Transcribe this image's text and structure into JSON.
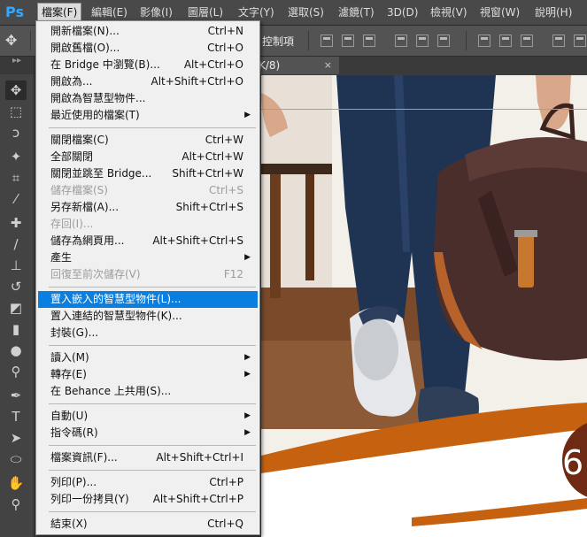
{
  "app": {
    "logo": "Ps"
  },
  "menubar": [
    {
      "label": "檔案(F)",
      "active": true
    },
    {
      "label": "編輯(E)"
    },
    {
      "label": "影像(I)"
    },
    {
      "label": "圖層(L)"
    },
    {
      "label": "文字(Y)"
    },
    {
      "label": "選取(S)"
    },
    {
      "label": "濾鏡(T)"
    },
    {
      "label": "3D(D)"
    },
    {
      "label": "檢視(V)"
    },
    {
      "label": "視窗(W)"
    },
    {
      "label": "說明(H)"
    }
  ],
  "options": {
    "control_label": "控制項"
  },
  "document": {
    "tab_label": "K/8)",
    "close_glyph": "×"
  },
  "canvas": {
    "partial_number": "6"
  },
  "file_menu": {
    "items": [
      {
        "label": "開新檔案(N)...",
        "shortcut": "Ctrl+N"
      },
      {
        "label": "開啟舊檔(O)...",
        "shortcut": "Ctrl+O"
      },
      {
        "label": "在 Bridge 中瀏覽(B)...",
        "shortcut": "Alt+Ctrl+O"
      },
      {
        "label": "開啟為...",
        "shortcut": "Alt+Shift+Ctrl+O"
      },
      {
        "label": "開啟為智慧型物件...",
        "shortcut": ""
      },
      {
        "label": "最近使用的檔案(T)",
        "shortcut": "",
        "submenu": true
      },
      {
        "separator": true
      },
      {
        "label": "關閉檔案(C)",
        "shortcut": "Ctrl+W"
      },
      {
        "label": "全部關閉",
        "shortcut": "Alt+Ctrl+W"
      },
      {
        "label": "關閉並跳至 Bridge...",
        "shortcut": "Shift+Ctrl+W"
      },
      {
        "label": "儲存檔案(S)",
        "shortcut": "Ctrl+S",
        "disabled": true
      },
      {
        "label": "另存新檔(A)...",
        "shortcut": "Shift+Ctrl+S"
      },
      {
        "label": "存回(I)...",
        "shortcut": "",
        "disabled": true
      },
      {
        "label": "儲存為網頁用...",
        "shortcut": "Alt+Shift+Ctrl+S"
      },
      {
        "label": "產生",
        "shortcut": "",
        "submenu": true
      },
      {
        "label": "回復至前次儲存(V)",
        "shortcut": "F12",
        "disabled": true
      },
      {
        "separator": true
      },
      {
        "label": "置入嵌入的智慧型物件(L)...",
        "shortcut": "",
        "highlight": true
      },
      {
        "label": "置入連結的智慧型物件(K)...",
        "shortcut": ""
      },
      {
        "label": "封裝(G)...",
        "shortcut": ""
      },
      {
        "separator": true
      },
      {
        "label": "讀入(M)",
        "shortcut": "",
        "submenu": true
      },
      {
        "label": "轉存(E)",
        "shortcut": "",
        "submenu": true
      },
      {
        "label": "在 Behance 上共用(S)...",
        "shortcut": ""
      },
      {
        "separator": true
      },
      {
        "label": "自動(U)",
        "shortcut": "",
        "submenu": true
      },
      {
        "label": "指令碼(R)",
        "shortcut": "",
        "submenu": true
      },
      {
        "separator": true
      },
      {
        "label": "檔案資訊(F)...",
        "shortcut": "Alt+Shift+Ctrl+I"
      },
      {
        "separator": true
      },
      {
        "label": "列印(P)...",
        "shortcut": "Ctrl+P"
      },
      {
        "label": "列印一份拷貝(Y)",
        "shortcut": "Alt+Shift+Ctrl+P"
      },
      {
        "separator": true
      },
      {
        "label": "結束(X)",
        "shortcut": "Ctrl+Q"
      }
    ],
    "submenu_glyph": "▶"
  },
  "tools": [
    {
      "icon": "move-tool-icon",
      "glyph": "✥",
      "selected": true
    },
    {
      "icon": "marquee-tool-icon",
      "glyph": "⬚"
    },
    {
      "icon": "lasso-tool-icon",
      "glyph": "ↄ"
    },
    {
      "icon": "magic-wand-tool-icon",
      "glyph": "✦"
    },
    {
      "icon": "crop-tool-icon",
      "glyph": "⌗"
    },
    {
      "icon": "eyedropper-tool-icon",
      "glyph": "⁄"
    },
    {
      "icon": "healing-brush-tool-icon",
      "glyph": "✚"
    },
    {
      "icon": "brush-tool-icon",
      "glyph": "∕"
    },
    {
      "icon": "clone-stamp-tool-icon",
      "glyph": "⊥"
    },
    {
      "icon": "history-brush-tool-icon",
      "glyph": "↺"
    },
    {
      "icon": "eraser-tool-icon",
      "glyph": "◩"
    },
    {
      "icon": "gradient-tool-icon",
      "glyph": "▮"
    },
    {
      "icon": "blur-tool-icon",
      "glyph": "●"
    },
    {
      "icon": "dodge-tool-icon",
      "glyph": "⚲"
    },
    {
      "icon": "pen-tool-icon",
      "glyph": "✒"
    },
    {
      "icon": "type-tool-icon",
      "glyph": "T"
    },
    {
      "icon": "path-selection-tool-icon",
      "glyph": "➤"
    },
    {
      "icon": "shape-tool-icon",
      "glyph": "⬭"
    },
    {
      "icon": "hand-tool-icon",
      "glyph": "✋"
    },
    {
      "icon": "zoom-tool-icon",
      "glyph": "⚲"
    }
  ],
  "colors": {
    "accent": "#31a8ff",
    "highlight": "#0b7fe0",
    "canvas_orange": "#c6620f"
  }
}
